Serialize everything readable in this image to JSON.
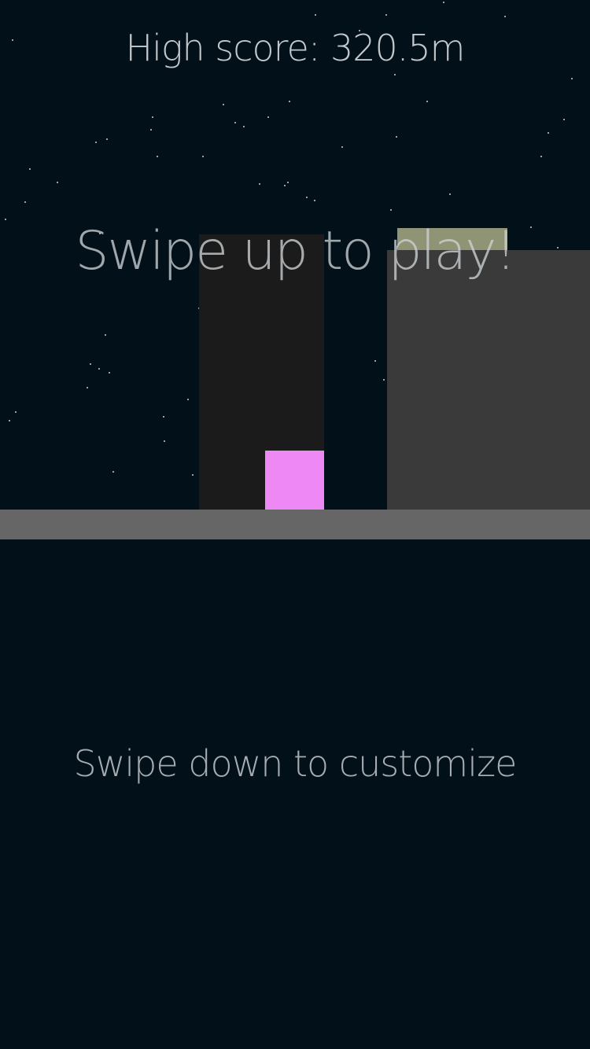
{
  "hud": {
    "high_score_text": "High score: 320.5m"
  },
  "prompts": {
    "swipe_up": "Swipe up to play!",
    "swipe_down": "Swipe down to customize"
  },
  "colors": {
    "background": "#02101a",
    "player": "#ee88f4",
    "ground": "#666666",
    "tower_dark": "#1b1b1b",
    "tower_gray": "#3a3a3a",
    "olive_block": "#8f9474"
  }
}
